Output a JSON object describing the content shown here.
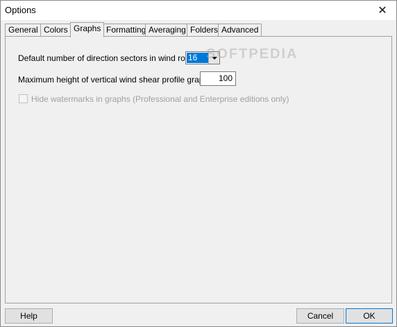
{
  "window": {
    "title": "Options"
  },
  "tabs": [
    {
      "label": "General"
    },
    {
      "label": "Colors"
    },
    {
      "label": "Graphs"
    },
    {
      "label": "Formatting"
    },
    {
      "label": "Averaging"
    },
    {
      "label": "Folders"
    },
    {
      "label": "Advanced"
    }
  ],
  "graphs": {
    "sectors_label": "Default number of direction sectors in wind roses",
    "sectors_value": "16",
    "shear_label": "Maximum height of vertical wind shear profile graph (m)",
    "shear_value": "100",
    "watermark_label": "Hide watermarks in graphs  (Professional and Enterprise editions only)"
  },
  "watermark_text": "SOFTPEDIA",
  "buttons": {
    "help": "Help",
    "cancel": "Cancel",
    "ok": "OK"
  },
  "icons": {
    "close": "close-icon",
    "dropdown": "chevron-down-icon"
  }
}
